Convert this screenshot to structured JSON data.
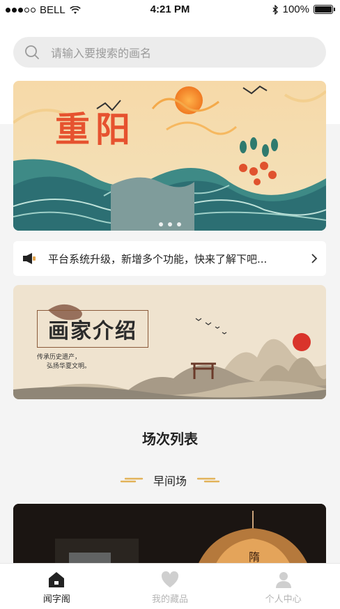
{
  "status": {
    "carrier": "BELL",
    "time": "4:21 PM",
    "battery": "100%"
  },
  "search": {
    "placeholder": "请输入要搜索的画名"
  },
  "banner": {
    "calligraphy": "重阳",
    "page_count": 3,
    "active_page": 1
  },
  "notice": {
    "text": "平台系统升级，新增多个功能，快来了解下吧..."
  },
  "intro_card": {
    "title": "画家介绍",
    "subtitle_lines": [
      "传承历史遗产，",
      "弘扬华夏文明。"
    ]
  },
  "section": {
    "title": "场次列表",
    "session_name": "早间场"
  },
  "tabs": [
    {
      "label": "闻字阁",
      "icon": "home-icon",
      "active": true
    },
    {
      "label": "我的藏品",
      "icon": "heart-icon",
      "active": false
    },
    {
      "label": "个人中心",
      "icon": "user-icon",
      "active": false
    }
  ],
  "colors": {
    "accent": "#e07a3c",
    "tab_active": "#222222",
    "tab_inactive": "#b5b5b5"
  }
}
